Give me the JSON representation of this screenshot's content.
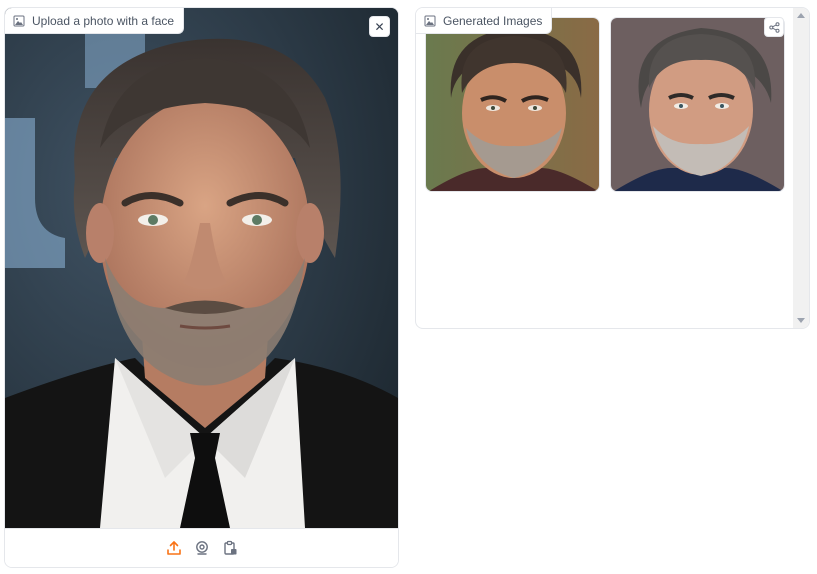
{
  "upload": {
    "label": "Upload a photo with a face",
    "clear_symbol": "✕",
    "image_icon": "image-icon",
    "toolbar": {
      "upload_icon": "upload-icon",
      "webcam_icon": "webcam-icon",
      "clipboard_icon": "clipboard-icon",
      "accent_color": "#f97316"
    }
  },
  "gallery": {
    "label": "Generated Images",
    "image_icon": "image-icon",
    "share_icon": "share-icon",
    "items": [
      "generated-portrait-1",
      "generated-portrait-2"
    ]
  },
  "colors": {
    "border": "#e5e7eb",
    "label_text": "#4b5563",
    "accent": "#f97316"
  }
}
